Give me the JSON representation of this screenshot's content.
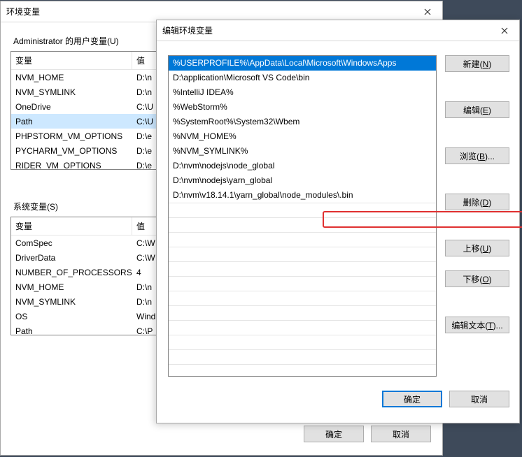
{
  "backDialog": {
    "title": "环境变量",
    "userVarsLabel": "Administrator 的用户变量(U)",
    "sysVarsLabel": "系统变量(S)",
    "header": {
      "name": "变量",
      "value": "值"
    },
    "userVars": [
      {
        "name": "NVM_HOME",
        "value": "D:\\n"
      },
      {
        "name": "NVM_SYMLINK",
        "value": "D:\\n"
      },
      {
        "name": "OneDrive",
        "value": "C:\\U"
      },
      {
        "name": "Path",
        "value": "C:\\U"
      },
      {
        "name": "PHPSTORM_VM_OPTIONS",
        "value": "D:\\e"
      },
      {
        "name": "PYCHARM_VM_OPTIONS",
        "value": "D:\\e"
      },
      {
        "name": "RIDER_VM_OPTIONS",
        "value": "D:\\e"
      }
    ],
    "sysVars": [
      {
        "name": "ComSpec",
        "value": "C:\\W"
      },
      {
        "name": "DriverData",
        "value": "C:\\W"
      },
      {
        "name": "NUMBER_OF_PROCESSORS",
        "value": "4"
      },
      {
        "name": "NVM_HOME",
        "value": "D:\\n"
      },
      {
        "name": "NVM_SYMLINK",
        "value": "D:\\n"
      },
      {
        "name": "OS",
        "value": "Wind"
      },
      {
        "name": "Path",
        "value": "C:\\P"
      }
    ],
    "okLabel": "确定",
    "cancelLabel": "取消"
  },
  "frontDialog": {
    "title": "编辑环境变量",
    "items": [
      "%USERPROFILE%\\AppData\\Local\\Microsoft\\WindowsApps",
      "D:\\application\\Microsoft VS Code\\bin",
      "%IntelliJ IDEA%",
      "%WebStorm%",
      "%SystemRoot%\\System32\\Wbem",
      "%NVM_HOME%",
      "%NVM_SYMLINK%",
      "D:\\nvm\\nodejs\\node_global",
      "D:\\nvm\\nodejs\\yarn_global",
      "D:\\nvm\\v18.14.1\\yarn_global\\node_modules\\.bin"
    ],
    "selectedIndex": 0,
    "highlightedIndex": 9,
    "buttons": {
      "new": "新建(N)",
      "edit": "编辑(E)",
      "browse": "浏览(B)...",
      "delete": "删除(D)",
      "moveUp": "上移(U)",
      "moveDown": "下移(O)",
      "editText": "编辑文本(T)..."
    },
    "okLabel": "确定",
    "cancelLabel": "取消"
  }
}
